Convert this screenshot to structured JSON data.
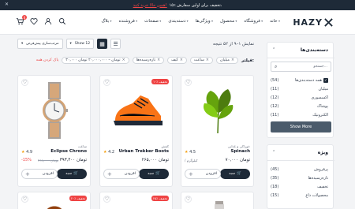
{
  "topbar": {
    "message": "۱۵٪ تخفیف برای اولین سفارش،",
    "link": "همین حالا خرید کنید!",
    "close": "✕"
  },
  "header": {
    "logo": "HAZY",
    "nav": [
      "خانه",
      "فروشگاه",
      "محصول",
      "ویژگی‌ها",
      "دسته‌بندی",
      "صفحات",
      "فروشنده",
      "بلاگ"
    ],
    "cart_count": "0"
  },
  "toolbar": {
    "results": "نمایش ۱–۹ از ۵۲ نتیجه",
    "sort_label": "مرتب‌سازی پیش‌فرض",
    "per_page": "Show 12"
  },
  "filters": {
    "label": "فیلتر:",
    "chips": [
      "میلیان",
      "ساعت",
      "کیف",
      "تازه‌رسیده‌ها",
      "۳۰,۰۰۰ تومان – ۲۰,۰۰۰,۰۰۰ تومان"
    ],
    "clear": "پاک کردن همه"
  },
  "products": [
    {
      "name": "Spinach",
      "cat": "خوراکی و غذایی",
      "rating": "4.5",
      "price": "۷۰,۰۰۰ تومان",
      "unit": "/ کیلوگرم",
      "badge": "",
      "add": "سبد",
      "qty": "افزودن"
    },
    {
      "name": "Urban Trekker Boots",
      "cat": "کفش",
      "rating": "4.2",
      "price": "۲۶۵,۰۰۰ تومان",
      "old": "",
      "pct": "",
      "badge": "۱۰٪ تخفیف",
      "add": "سبد",
      "qty": "افزودن"
    },
    {
      "name": "Eclipse Chrono",
      "cat": "ساعت",
      "rating": "4.9",
      "price": "۳۹۳,۴۰۰ تومان",
      "old": "۴۶۸,۰۰۰ تومان",
      "pct": "-15%",
      "badge": "",
      "add": "سبد",
      "qty": "افزودن"
    }
  ],
  "row2": {
    "badges": [
      "۲۵٪ تخفیف",
      "۲۰٪ تخفیف"
    ]
  },
  "categories": {
    "title": "دسته‌بندی‌ها",
    "search_placeholder": "جستجو...",
    "items": [
      {
        "label": "همه دسته‌بندی‌ها",
        "count": "(54)",
        "checked": true
      },
      {
        "label": "میلیان",
        "count": "(11)",
        "checked": false
      },
      {
        "label": "اکسسوری",
        "count": "(12)",
        "checked": false
      },
      {
        "label": "پوشاک",
        "count": "(12)",
        "checked": false
      },
      {
        "label": "الکترونیک",
        "count": "(11)",
        "checked": false
      }
    ],
    "show_more": "Show More"
  },
  "special": {
    "title": "ویژه",
    "items": [
      {
        "label": "پرفروش",
        "count": "(45)"
      },
      {
        "label": "تازه‌رسیده‌ها",
        "count": "(35)"
      },
      {
        "label": "تخفیف",
        "count": "(18)"
      },
      {
        "label": "محصولات داغ",
        "count": "(15)"
      }
    ]
  },
  "colors": {
    "primary": "#1e2a38",
    "accent": "#ef4444",
    "star": "#f59e0b"
  }
}
